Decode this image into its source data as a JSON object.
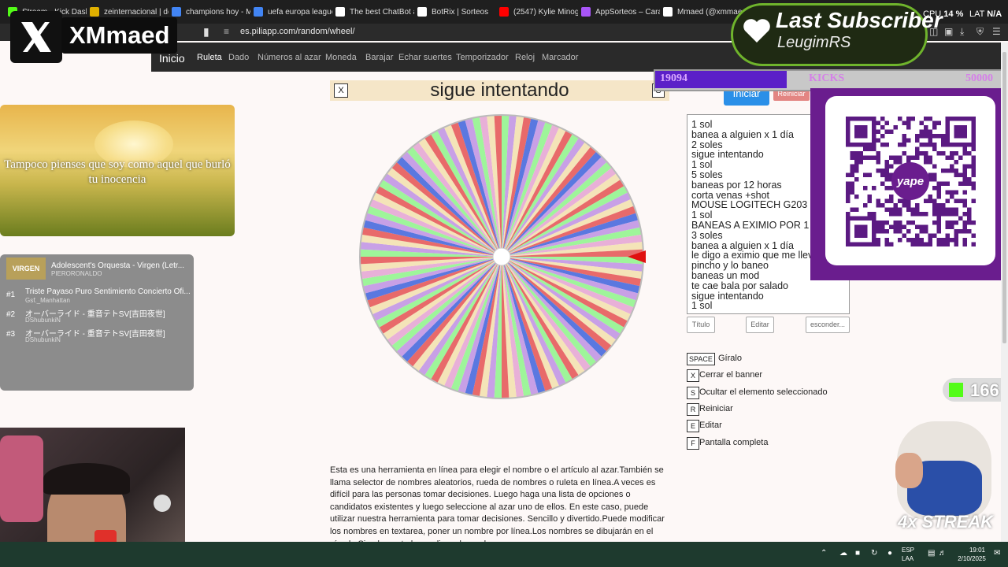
{
  "browser": {
    "tabs": [
      {
        "label": "Stream - Kick Dashb",
        "color": "#53fc18"
      },
      {
        "label": "zeinternacional | do",
        "color": "#e0b000"
      },
      {
        "label": "champions hoy - M",
        "color": "#4285f4"
      },
      {
        "label": "uefa europa league",
        "color": "#4285f4"
      },
      {
        "label": "The best ChatBot a",
        "color": "#ffffff"
      },
      {
        "label": "BotRix | Sorteos",
        "color": "#ffffff"
      },
      {
        "label": "(2547) Kylie Minogu",
        "color": "#ff0000"
      },
      {
        "label": "AppSorteos – Cara",
        "color": "#a855f7"
      },
      {
        "label": "Mmaed (@xmmaed",
        "color": "#ffffff"
      }
    ],
    "url": "es.piliapp.com/random/wheel/",
    "cpu_label": "CPU",
    "cpu_value": "14 %",
    "lat_label": "LAT",
    "lat_value": "N/A"
  },
  "overlay": {
    "x_name": "XMmaed",
    "last_subscriber_title": "Last Subscriber",
    "last_subscriber_name": "LeugimRS",
    "goal_current": "19094",
    "goal_label": "KICKS",
    "goal_target": "50000",
    "goal_progress": 0.382,
    "viewers": "166",
    "streak": "4x STREAK",
    "qr_brand": "yape"
  },
  "site": {
    "nav": [
      "Inicio",
      "Ruleta",
      "Dado",
      "Números al azar",
      "Moneda",
      "Barajar",
      "Echar suertes",
      "Temporizador",
      "Reloj",
      "Marcador"
    ],
    "active_nav": "Ruleta",
    "result_title": "sigue intentando",
    "close_key": "X",
    "s_key": "S",
    "start_button": "Iniciar",
    "reset_button": "Reiniciar",
    "names": [
      "1 sol",
      "banea a alguien x 1 día",
      "2 soles",
      "sigue intentando",
      "1 sol",
      "5 soles",
      "baneas por 12 horas",
      "corta venas +shot",
      "MOUSE LOGITECH G203",
      "1 sol",
      "BANEAS A EXIMIO POR 1 DÍA",
      "3 soles",
      "banea a alguien x 1 día",
      "le digo a eximio que me lleve",
      "pincho y lo baneo",
      "baneas un mod",
      "te cae bala por salado",
      "sigue intentando",
      "1 sol"
    ],
    "title_button": "Título",
    "edit_button": "Editar",
    "hide_button": "esconder...",
    "shortcuts": [
      {
        "key": "SPACE",
        "label": "Gíralo"
      },
      {
        "key": "X",
        "label": "Cerrar el banner"
      },
      {
        "key": "S",
        "label": "Ocultar el elemento seleccionado"
      },
      {
        "key": "R",
        "label": "Reiniciar"
      },
      {
        "key": "E",
        "label": "Editar"
      },
      {
        "key": "F",
        "label": "Pantalla completa"
      }
    ],
    "description": "Esta es una herramienta en línea para elegir el nombre o el artículo al azar.También se llama selector de nombres aleatorios, rueda de nombres o ruleta en línea.A veces es difícil para las personas tomar decisiones. Luego haga una lista de opciones o candidatos existentes y luego seleccione al azar uno de ellos. En este caso, puede utilizar nuestra herramienta para tomar decisiones. Sencillo y divertido.Puede modificar los nombres en textarea, poner un nombre por línea.Los nombres se dibujarán en el círculo.Simplemente haga clic en la rueda",
    "wheel_colors": [
      "#9ef59a",
      "#c8a0e6",
      "#f4e4b8",
      "#e86a6a",
      "#5a78e0",
      "#e8b0d8"
    ]
  },
  "image_card": {
    "quote": "Tampoco pienses que soy como aquel que burló tu inocencia"
  },
  "playlist": {
    "now_playing_thumb": "VIRGEN",
    "now_playing_title": "Adolescent's Orquesta - Virgen (Letr...",
    "now_playing_artist": "PIERORONALDO",
    "queue": [
      {
        "num": "#1",
        "title": "Triste Payaso Puro Sentimiento Concierto Ofi...",
        "user": "Gsf._Manhattan"
      },
      {
        "num": "#2",
        "title": "オーバーライド - 重音テトSV[吉田夜世]",
        "user": "DShubunkiN"
      },
      {
        "num": "#3",
        "title": "オーバーライド - 重音テトSV[吉田夜世]",
        "user": "DShubunkiN"
      }
    ]
  },
  "taskbar": {
    "lang_top": "ESP",
    "lang_bottom": "LAA",
    "time": "19:01",
    "date": "2/10/2025"
  }
}
